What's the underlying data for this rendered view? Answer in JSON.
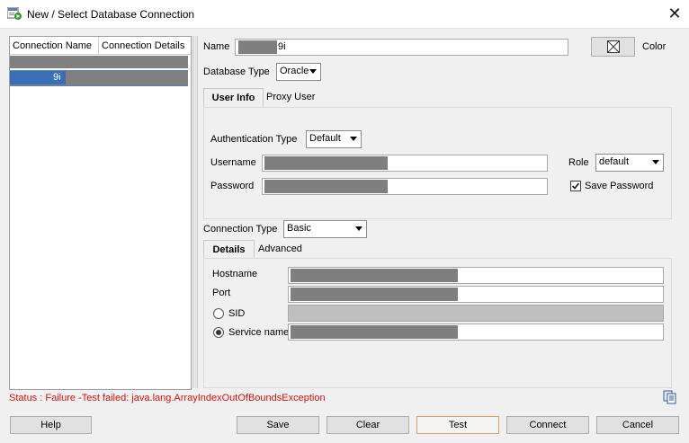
{
  "window": {
    "title": "New / Select Database Connection",
    "close_glyph": "✕"
  },
  "connections_table": {
    "columns": [
      "Connection Name",
      "Connection Details"
    ],
    "rows": [
      {
        "name": "",
        "details": ""
      },
      {
        "name": "9i",
        "details": ""
      }
    ]
  },
  "form": {
    "name_label": "Name",
    "name_value": "9i",
    "color_label": "Color",
    "database_type_label": "Database Type",
    "database_type_value": "Oracle",
    "tabs": [
      "User Info",
      "Proxy User"
    ],
    "auth_type_label": "Authentication Type",
    "auth_type_value": "Default",
    "username_label": "Username",
    "password_label": "Password",
    "role_label": "Role",
    "role_value": "default",
    "save_password_label": "Save Password",
    "save_password_checked": true,
    "connection_type_label": "Connection Type",
    "connection_type_value": "Basic",
    "detail_tabs": [
      "Details",
      "Advanced"
    ],
    "hostname_label": "Hostname",
    "port_label": "Port",
    "sid_label": "SID",
    "service_name_label": "Service name",
    "service_name_selected": true
  },
  "status": "Status : Failure -Test failed: java.lang.ArrayIndexOutOfBoundsException",
  "buttons": {
    "help": "Help",
    "save": "Save",
    "clear": "Clear",
    "test": "Test",
    "connect": "Connect",
    "cancel": "Cancel"
  },
  "icons": {
    "app": "database-connect-icon",
    "color_picker": "color-picker-icon",
    "clipboard": "copy-log-icon"
  }
}
